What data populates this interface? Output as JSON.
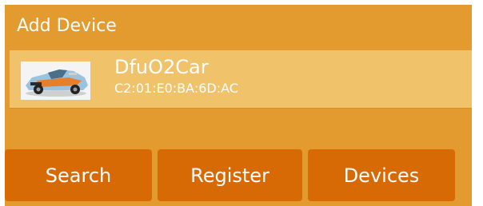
{
  "header": {
    "title": "Add Device"
  },
  "devices": [
    {
      "name": "DfuO2Car",
      "address": "C2:01:E0:BA:6D:AC",
      "thumbnail_icon": "race-car-icon"
    }
  ],
  "footer": {
    "search_label": "Search",
    "register_label": "Register",
    "devices_label": "Devices"
  },
  "colors": {
    "panel": "#e39a2e",
    "selected_row": "#f0c26a",
    "button": "#d86a06",
    "text": "#ffffff"
  }
}
